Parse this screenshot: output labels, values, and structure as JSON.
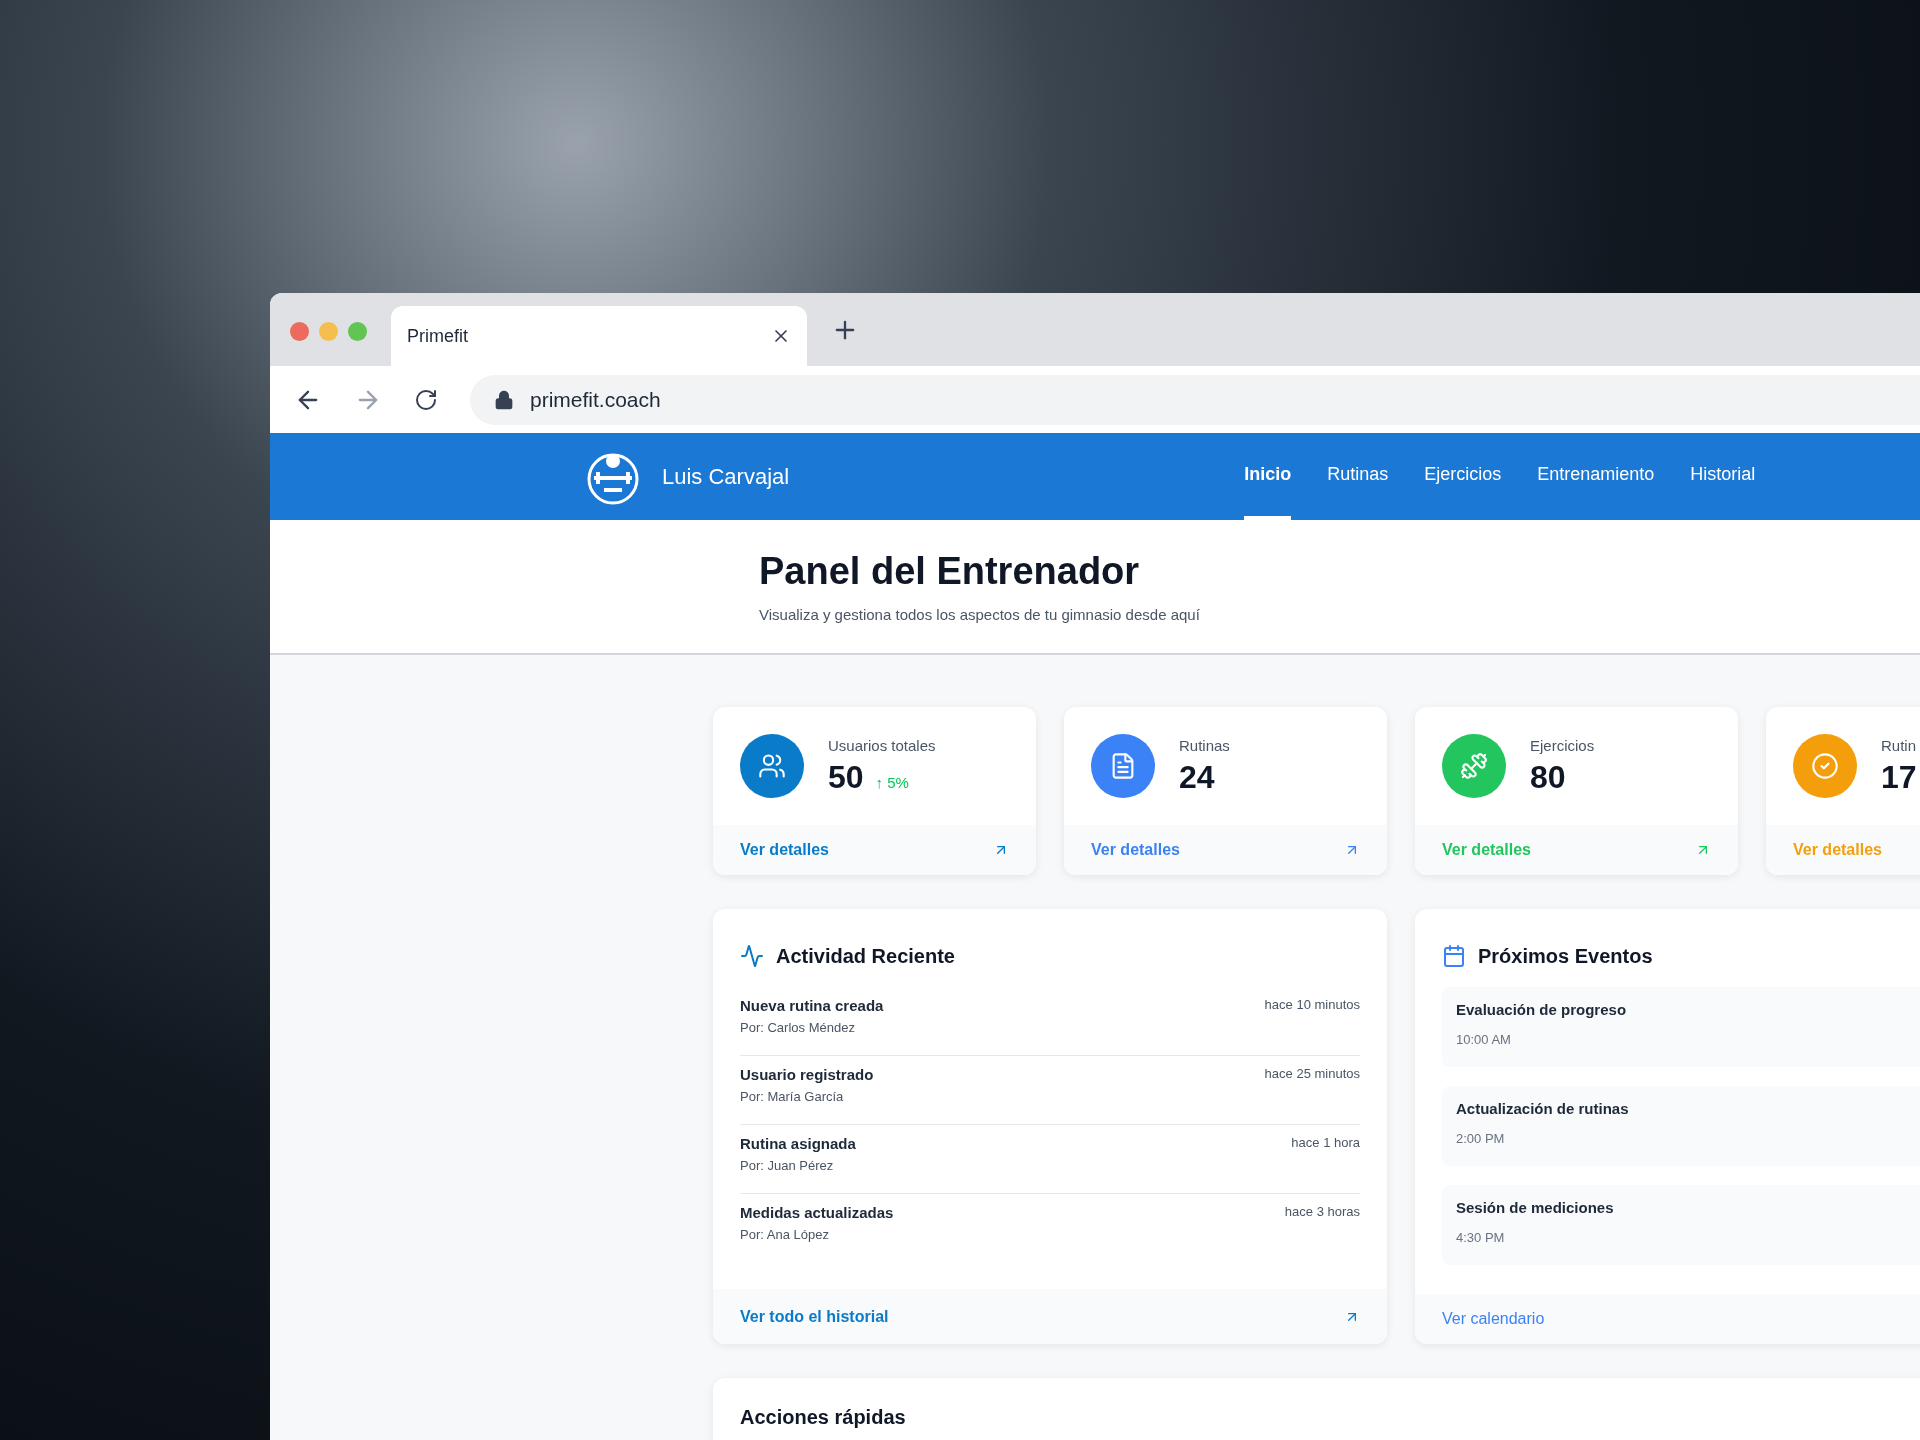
{
  "browser": {
    "tab_title": "Primefit",
    "url": "primefit.coach"
  },
  "navbar": {
    "brand": "Luis Carvajal",
    "links": [
      {
        "label": "Inicio",
        "selected": true
      },
      {
        "label": "Rutinas",
        "selected": false
      },
      {
        "label": "Ejercicios",
        "selected": false
      },
      {
        "label": "Entrenamiento",
        "selected": false
      },
      {
        "label": "Historial",
        "selected": false
      }
    ]
  },
  "header": {
    "title": "Panel del Entrenador",
    "subtitle": "Visualiza y gestiona todos los aspectos de tu gimnasio desde aquí"
  },
  "stats": [
    {
      "kind": "users",
      "label": "Usuarios totales",
      "value": "50",
      "trend": "↑ 5%",
      "link": "Ver detalles",
      "color": "#0a7bc8"
    },
    {
      "kind": "routines",
      "label": "Rutinas",
      "value": "24",
      "link": "Ver detalles",
      "color": "#3b82f6"
    },
    {
      "kind": "exercises",
      "label": "Ejercicios",
      "value": "80",
      "link": "Ver detalles",
      "color": "#22c55e"
    },
    {
      "kind": "done",
      "label": "Rutin",
      "value": "17",
      "link": "Ver detalles",
      "color": "#f59e0b"
    }
  ],
  "activity": {
    "title": "Actividad Reciente",
    "items": [
      {
        "title": "Nueva rutina creada",
        "by": "Por: Carlos Méndez",
        "time": "hace 10 minutos"
      },
      {
        "title": "Usuario registrado",
        "by": "Por: María García",
        "time": "hace 25 minutos"
      },
      {
        "title": "Rutina asignada",
        "by": "Por: Juan Pérez",
        "time": "hace 1 hora"
      },
      {
        "title": "Medidas actualizadas",
        "by": "Por: Ana López",
        "time": "hace 3 horas"
      }
    ],
    "link": "Ver todo el historial"
  },
  "events": {
    "title": "Próximos Eventos",
    "items": [
      {
        "title": "Evaluación de progreso",
        "time": "10:00 AM"
      },
      {
        "title": "Actualización de rutinas",
        "time": "2:00 PM"
      },
      {
        "title": "Sesión de mediciones",
        "time": "4:30 PM"
      }
    ],
    "link": "Ver calendario"
  },
  "quick_actions": {
    "title": "Acciones rápidas"
  }
}
